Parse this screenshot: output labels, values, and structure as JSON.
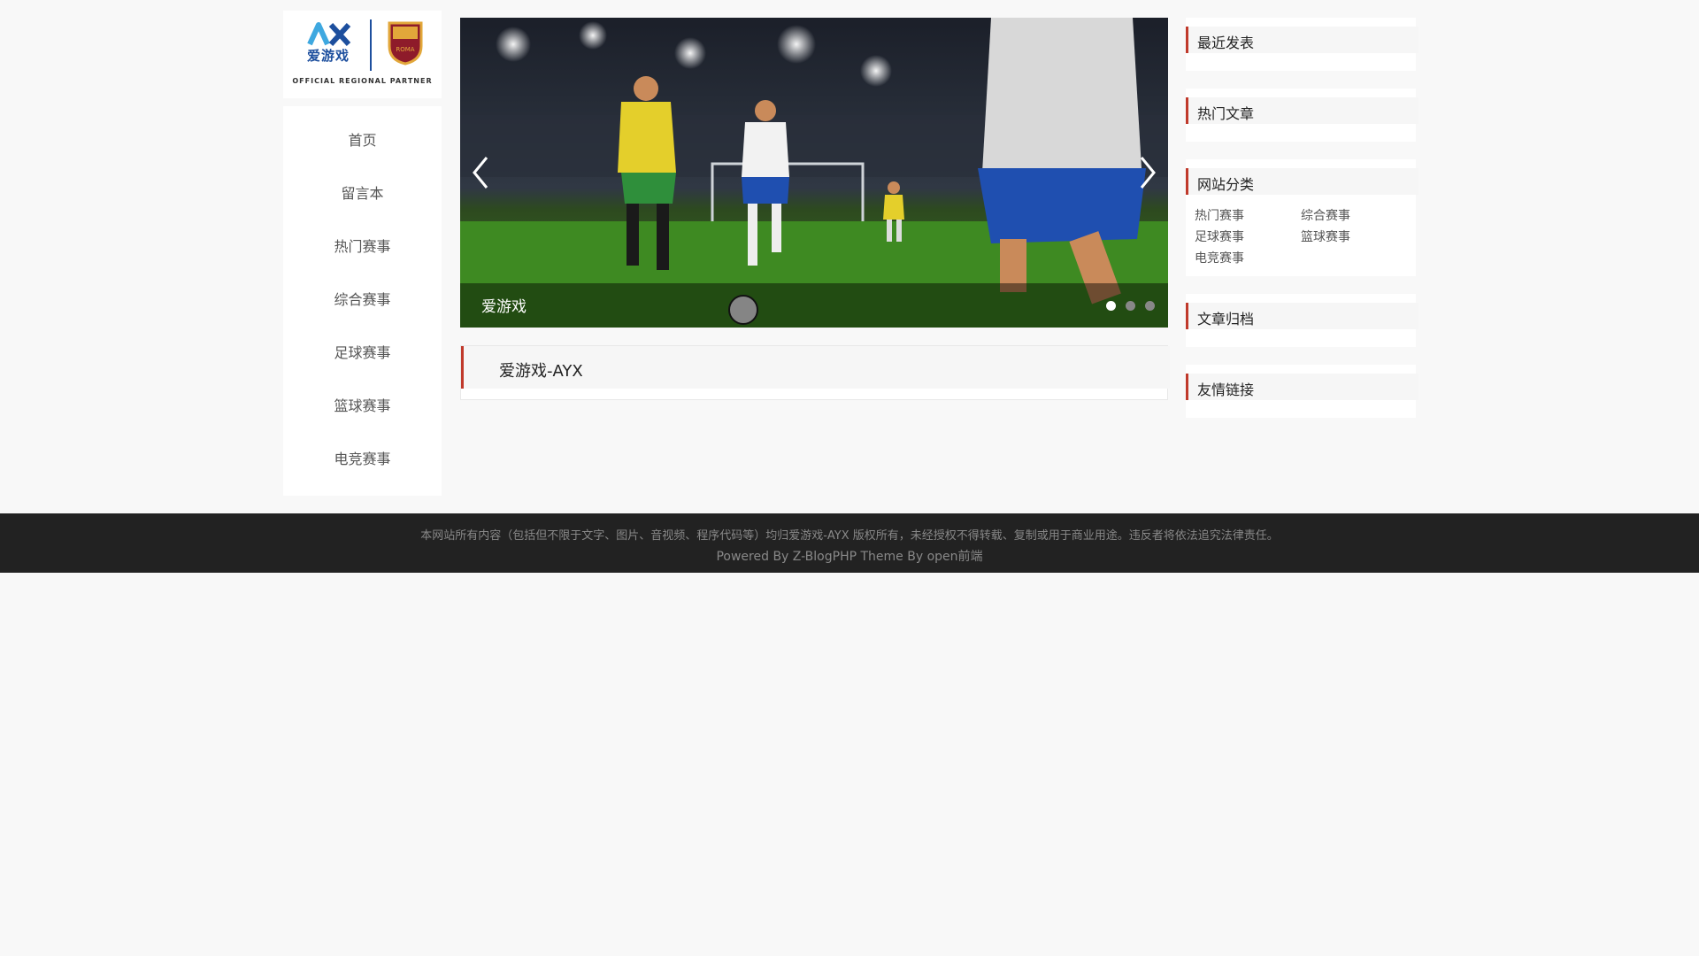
{
  "logo": {
    "cn_text": "爱游戏",
    "roma_text": "ROMA",
    "tagline": "OFFICIAL REGIONAL PARTNER"
  },
  "nav": {
    "items": [
      {
        "label": "首页"
      },
      {
        "label": "留言本"
      },
      {
        "label": "热门赛事"
      },
      {
        "label": "综合赛事"
      },
      {
        "label": "足球赛事"
      },
      {
        "label": "篮球赛事"
      },
      {
        "label": "电竞赛事"
      }
    ]
  },
  "slider": {
    "caption": "爱游戏",
    "dots": 3,
    "active_dot": 0
  },
  "post": {
    "title": "爱游戏-AYX"
  },
  "sidebar": {
    "recent": {
      "title": "最近发表"
    },
    "hot": {
      "title": "热门文章"
    },
    "categories": {
      "title": "网站分类",
      "items": [
        {
          "label": "热门赛事"
        },
        {
          "label": "综合赛事"
        },
        {
          "label": "足球赛事"
        },
        {
          "label": "篮球赛事"
        },
        {
          "label": "电竞赛事"
        }
      ]
    },
    "archive": {
      "title": "文章归档"
    },
    "links": {
      "title": "友情链接"
    }
  },
  "footer": {
    "copyright": "本网站所有内容（包括但不限于文字、图片、音视频、程序代码等）均归爱游戏-AYX 版权所有，未经授权不得转载、复制或用于商业用途。违反者将依法追究法律责任。",
    "powered": "Powered By Z-BlogPHP Theme By open前端"
  },
  "colors": {
    "accent": "#c0392b",
    "brand_blue": "#1d4f9e",
    "footer_bg": "#222222",
    "page_bg": "#f8f8f8"
  }
}
